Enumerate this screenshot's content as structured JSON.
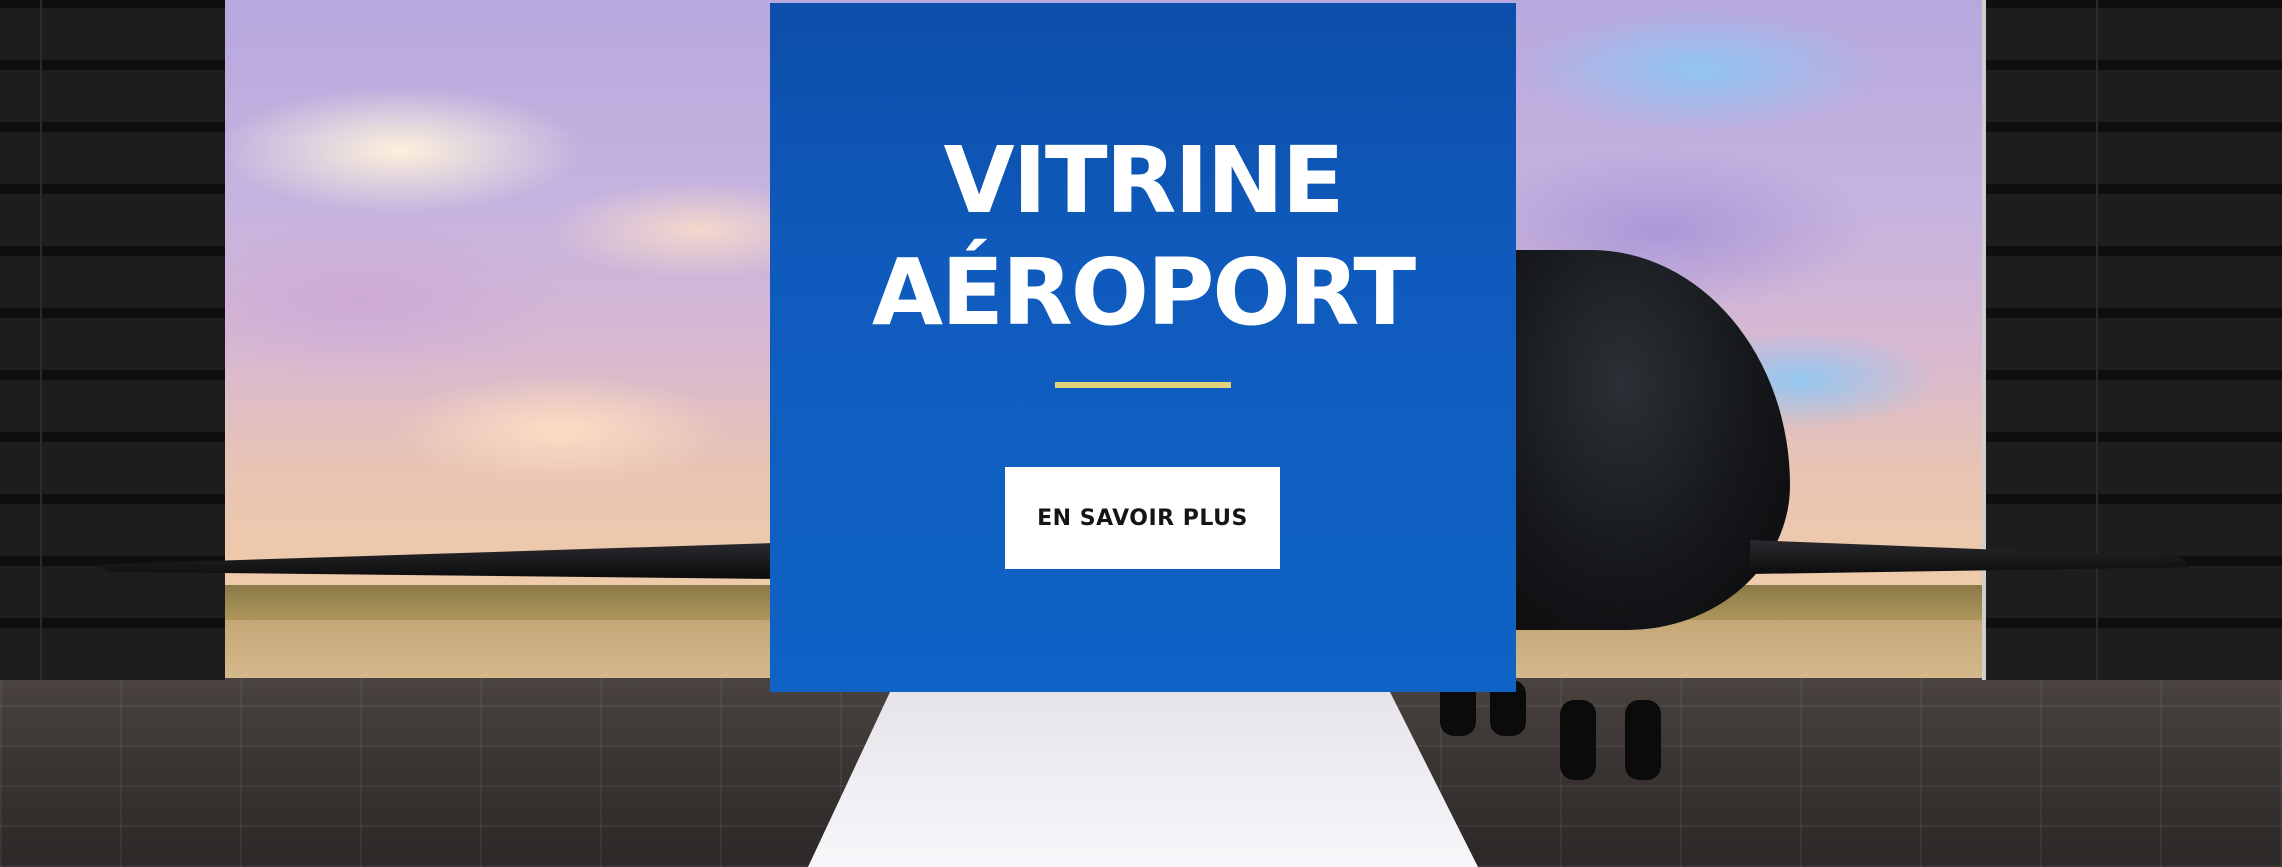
{
  "hero": {
    "title_line1": "VITRINE",
    "title_line2": "AÉROPORT",
    "cta_label": "EN SAVOIR PLUS"
  },
  "colors": {
    "panel_blue": "#0f5bbd",
    "accent_gold": "#e0d279",
    "button_bg": "#ffffff",
    "button_text": "#151515"
  },
  "background": {
    "image_description_icon": "private-jet-hangar-scene"
  }
}
